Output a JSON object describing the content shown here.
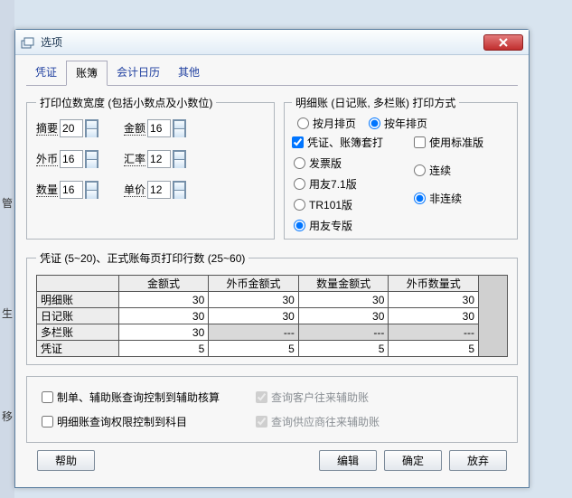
{
  "window": {
    "title": "选项"
  },
  "tabs": [
    "凭证",
    "账簿",
    "会计日历",
    "其他"
  ],
  "activeTab": 1,
  "printWidth": {
    "legend": "打印位数宽度 (包括小数点及小数位)",
    "fields": {
      "summary": {
        "label": "摘要",
        "value": "20"
      },
      "amount": {
        "label": "金额",
        "value": "16"
      },
      "foreign": {
        "label": "外币",
        "value": "16"
      },
      "rate": {
        "label": "汇率",
        "value": "12"
      },
      "qty": {
        "label": "数量",
        "value": "16"
      },
      "price": {
        "label": "单价",
        "value": "12"
      }
    }
  },
  "printMode": {
    "legend": "明细账 (日记账, 多栏账) 打印方式",
    "byMonth": "按月排页",
    "byYear": "按年排页",
    "mode": "byYear",
    "sets_check_label": "凭证、账簿套打",
    "sets_check": true,
    "versionOptions": [
      "发票版",
      "用友7.1版",
      "TR101版",
      "用友专版"
    ],
    "version": "用友专版",
    "std_label": "使用标准版",
    "std": false,
    "cont": "连续",
    "noncont": "非连续",
    "contMode": "noncont"
  },
  "lines": {
    "legend": "凭证 (5~20)、正式账每页打印行数 (25~60)",
    "columns": [
      "金额式",
      "外币金额式",
      "数量金额式",
      "外币数量式"
    ],
    "rows": [
      {
        "label": "明细账",
        "values": [
          "30",
          "30",
          "30",
          "30"
        ]
      },
      {
        "label": "日记账",
        "values": [
          "30",
          "30",
          "30",
          "30"
        ]
      },
      {
        "label": "多栏账",
        "values": [
          "30",
          "---",
          "---",
          "---"
        ]
      },
      {
        "label": "凭证",
        "values": [
          "5",
          "5",
          "5",
          "5"
        ]
      }
    ]
  },
  "bottom": {
    "opt1": "制单、辅助账查询控制到辅助核算",
    "opt2": "明细账查询权限控制到科目",
    "opt3": "查询客户往来辅助账",
    "opt4": "查询供应商往来辅助账",
    "v1": false,
    "v2": false,
    "v3": true,
    "v4": true
  },
  "buttons": {
    "help": "帮助",
    "edit": "编辑",
    "ok": "确定",
    "cancel": "放弃"
  },
  "bgLabels": {
    "a": "管",
    "b": "生",
    "c": "移"
  }
}
